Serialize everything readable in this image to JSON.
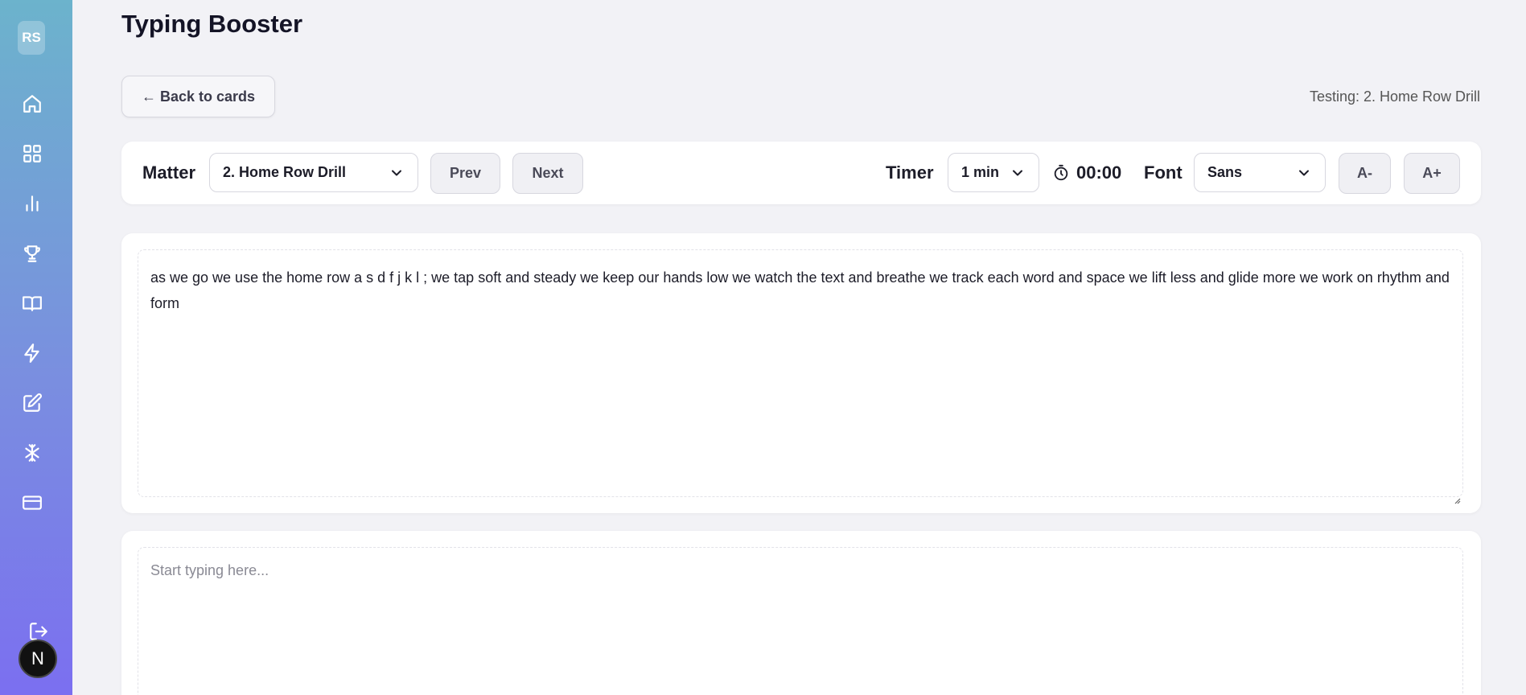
{
  "app": {
    "title": "Typing Booster",
    "user_initials": "RS",
    "n_badge": "N"
  },
  "sidebar": {
    "icons": [
      "home-icon",
      "grid-icon",
      "bar-chart-icon",
      "trophy-icon",
      "book-icon",
      "lightning-icon",
      "edit-icon",
      "sparkle-icon",
      "credit-card-icon"
    ],
    "logout_icon": "logout-icon"
  },
  "header": {
    "back_label": "← Back to cards",
    "testing_label": "Testing: 2. Home Row Drill"
  },
  "controls": {
    "matter_label": "Matter",
    "matter_value": "2. Home Row Drill",
    "prev_label": "Prev",
    "next_label": "Next",
    "timer_label": "Timer",
    "timer_value": "1 min",
    "timer_display": "00:00",
    "font_label": "Font",
    "font_value": "Sans",
    "font_decrease_label": "A-",
    "font_increase_label": "A+"
  },
  "matter": {
    "text": "as we go we use the home row a s d f j k l ; we tap soft and steady we keep our hands low we watch the text and breathe we track each word and space we lift less and glide more we work on rhythm and form"
  },
  "typing": {
    "placeholder": "Start typing here..."
  },
  "colors": {
    "sidebar_top": "#6cb3cc",
    "sidebar_bottom": "#7b6ff0",
    "background": "#f2f2f6"
  }
}
